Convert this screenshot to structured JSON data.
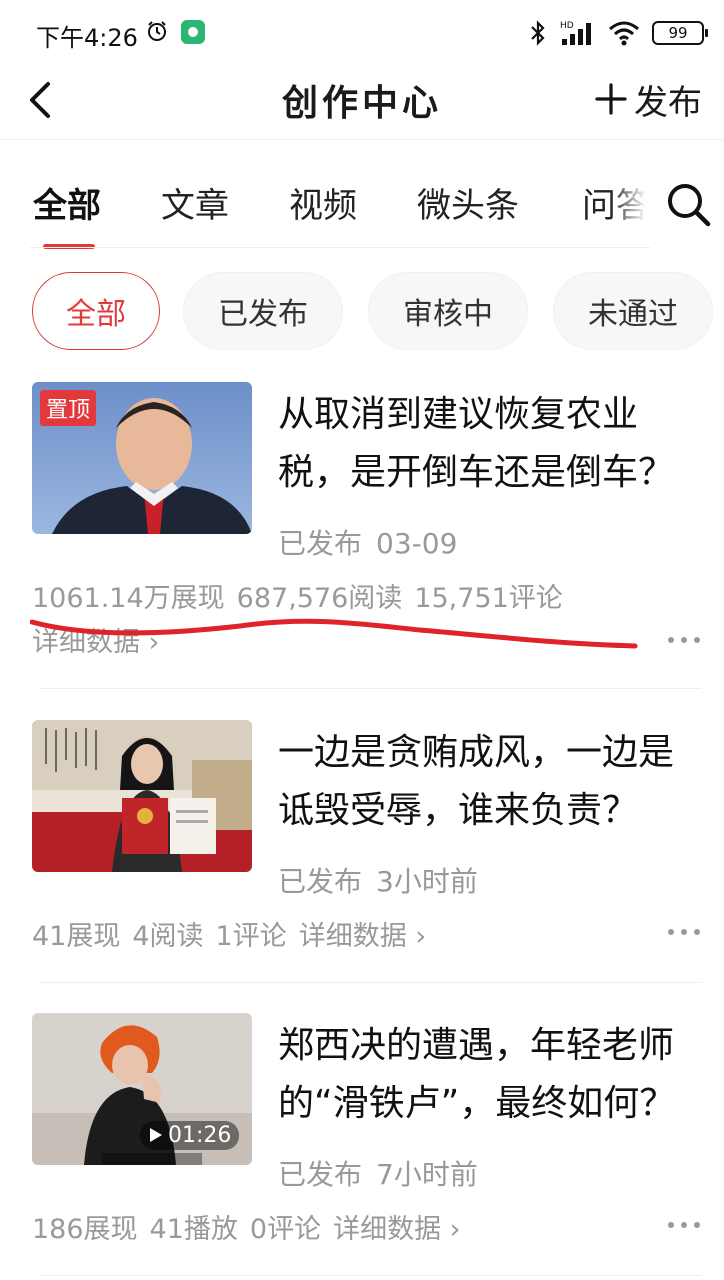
{
  "status_bar": {
    "time": "下午4:26",
    "battery": "99"
  },
  "header": {
    "title": "创作中心",
    "publish_label": "发布"
  },
  "tabs": [
    {
      "label": "全部",
      "active": true
    },
    {
      "label": "文章"
    },
    {
      "label": "视频"
    },
    {
      "label": "微头条"
    },
    {
      "label": "问答"
    }
  ],
  "filters": [
    {
      "label": "全部",
      "active": true
    },
    {
      "label": "已发布"
    },
    {
      "label": "审核中"
    },
    {
      "label": "未通过"
    }
  ],
  "articles": [
    {
      "pinned_label": "置顶",
      "title": "从取消到建议恢复农业税，是开倒车还是倒车？",
      "status": "已发布",
      "time": "03-09",
      "stats": [
        "1061.14万展现",
        "687,576阅读",
        "15,751评论"
      ],
      "detail_label": "详细数据 ›"
    },
    {
      "title": "一边是贪贿成风，一边是诋毁受辱，谁来负责？",
      "status": "已发布",
      "time": "3小时前",
      "stats": [
        "41展现",
        "4阅读",
        "1评论"
      ],
      "detail_label": "详细数据 ›"
    },
    {
      "title": "郑西决的遭遇，年轻老师的“滑铁卢”，最终如何？",
      "status": "已发布",
      "time": "7小时前",
      "stats": [
        "186展现",
        "41播放",
        "0评论"
      ],
      "detail_label": "详细数据 ›",
      "duration": "01:26"
    }
  ],
  "colors": {
    "accent": "#e4393c",
    "muted_text": "#999999"
  }
}
